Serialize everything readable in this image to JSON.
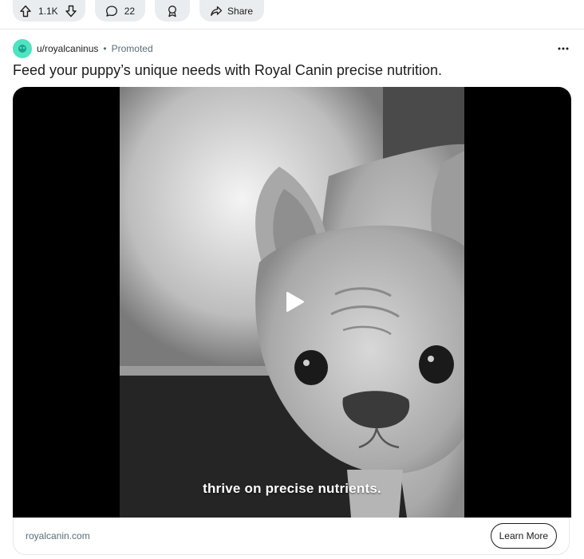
{
  "actions": {
    "vote_count": "1.1K",
    "comment_count": "22",
    "share_label": "Share"
  },
  "post": {
    "author": "u/royalcaninus",
    "separator": "•",
    "promoted_label": "Promoted",
    "title": "Feed your puppy’s unique needs with Royal Canin precise nutrition.",
    "caption": "thrive on precise nutrients.",
    "domain": "royalcanin.com",
    "cta_label": "Learn More"
  },
  "colors": {
    "pill_bg": "#eaedef",
    "avatar": "#4fe3c1",
    "meta_text": "#576f76",
    "media_bg": "#000000"
  },
  "icons": [
    "upvote-icon",
    "downvote-icon",
    "comment-icon",
    "award-icon",
    "share-icon",
    "more-options-icon",
    "play-icon"
  ]
}
